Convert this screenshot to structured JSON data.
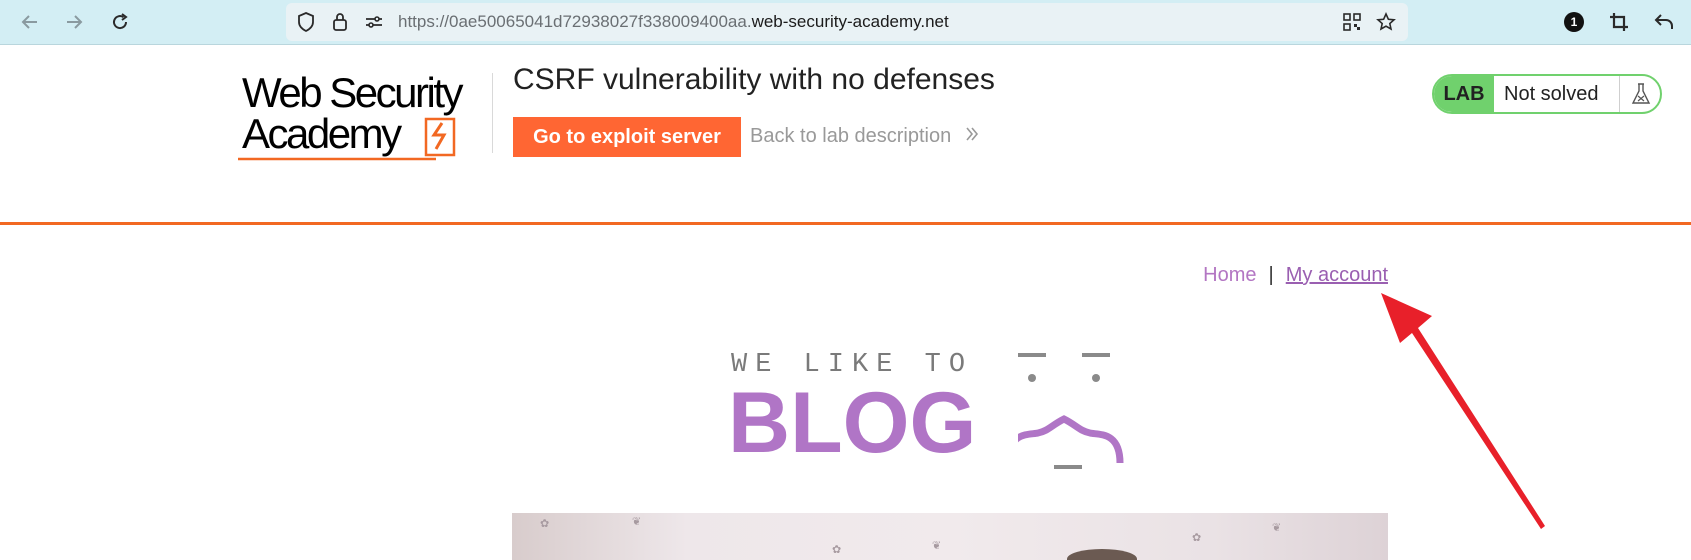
{
  "browser": {
    "url_prefix": "https://0ae50065041d72938027f338009400aa.",
    "url_host": "web-security-academy.net",
    "badge_count": "1"
  },
  "lab": {
    "logo_line1": "Web Security",
    "logo_line2": "Academy",
    "title": "CSRF vulnerability with no defenses",
    "exploit_button": "Go to exploit server",
    "back_link": "Back to lab description",
    "status_tag": "LAB",
    "status_text": "Not solved"
  },
  "blog": {
    "nav": {
      "home": "Home",
      "separator": "|",
      "my_account": "My account"
    },
    "banner_small": "WE LIKE TO",
    "banner_big": "BLOG"
  },
  "colors": {
    "accent_orange": "#ff6633",
    "lab_green": "#70d16d",
    "blog_purple": "#b075c6",
    "annotation_red": "#e8202a"
  }
}
